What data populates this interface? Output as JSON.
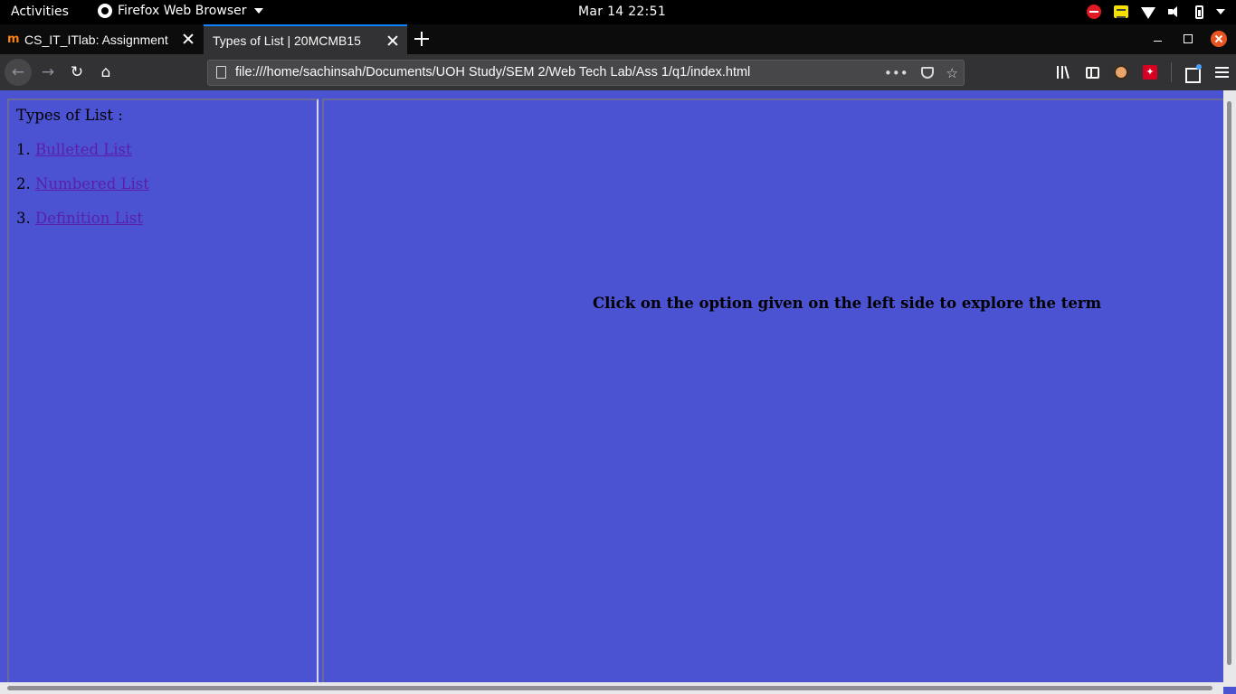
{
  "system": {
    "activities": "Activities",
    "app_name": "Firefox Web Browser",
    "clock": "Mar 14  22:51"
  },
  "tabs": [
    {
      "title": "CS_IT_ITlab: Assignment",
      "icon": "moodle-icon",
      "active": false
    },
    {
      "title": "Types of List | 20MCMB15",
      "icon": "",
      "active": true
    }
  ],
  "navbar": {
    "url": "file:///home/sachinsah/Documents/UOH Study/SEM 2/Web Tech Lab/Ass 1/q1/index.html",
    "page_actions_label": "•••"
  },
  "page": {
    "background": "#4c53d2",
    "link_color": "#5a1ea8",
    "left_frame": {
      "heading": "Types of List :",
      "items": [
        {
          "number": "1.",
          "label": "Bulleted List"
        },
        {
          "number": "2.",
          "label": "Numbered List"
        },
        {
          "number": "3.",
          "label": "Definition List"
        }
      ]
    },
    "right_frame": {
      "message": "Click on the option given on the left side to explore the term"
    }
  }
}
